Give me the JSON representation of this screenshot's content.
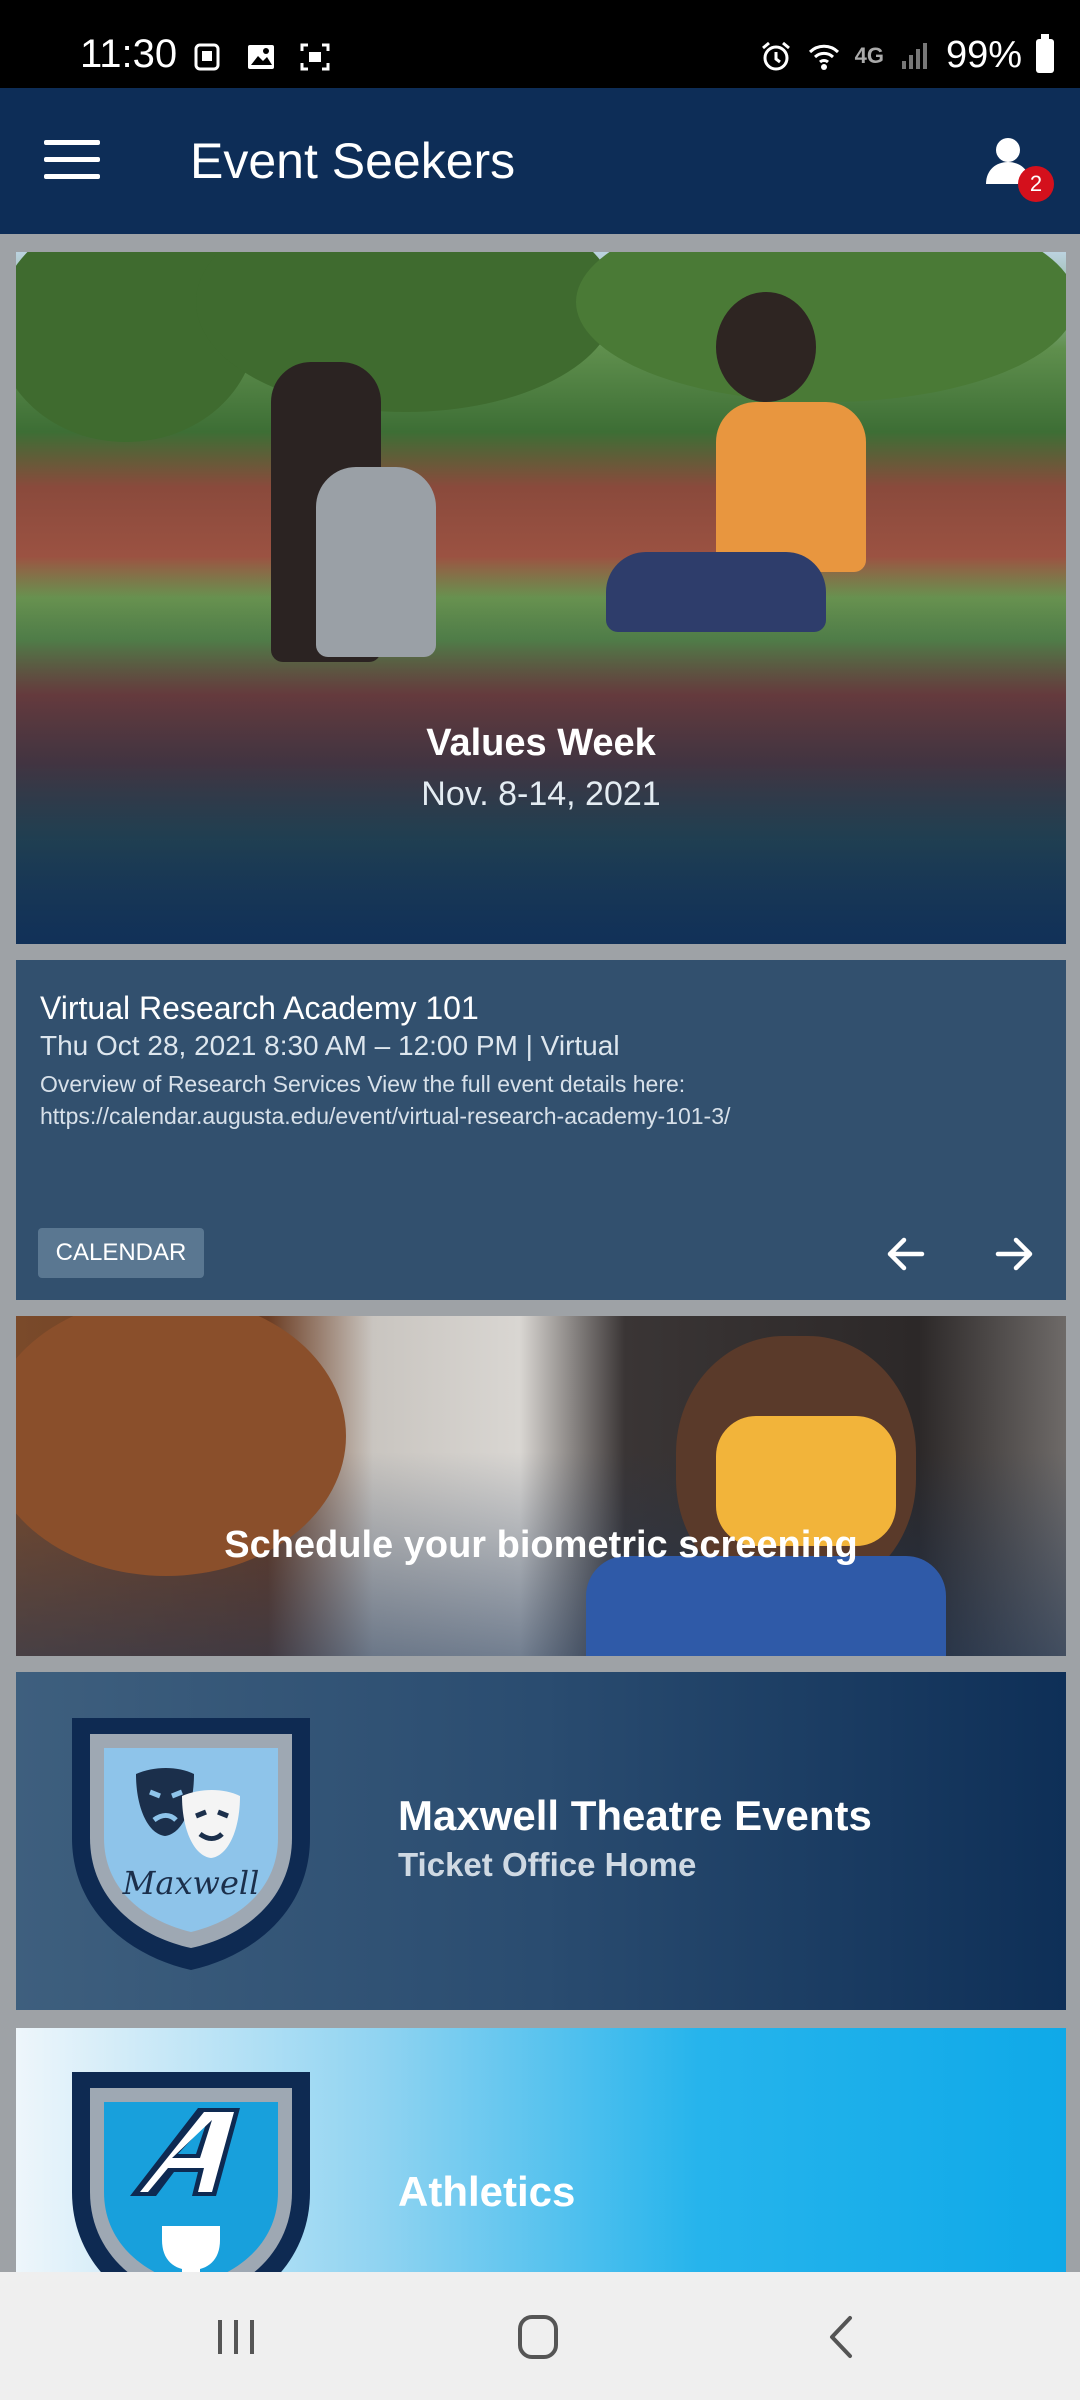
{
  "status_bar": {
    "time": "11:30",
    "left_icons": [
      "notification-icon",
      "image-icon",
      "screenshot-icon"
    ],
    "right_icons": [
      "alarm-icon",
      "wifi-icon",
      "signal-icon"
    ],
    "network": "4G",
    "battery": "99%"
  },
  "app_bar": {
    "title": "Event Seekers",
    "notification_count": "2"
  },
  "hero": {
    "title": "Values Week",
    "subtitle": "Nov. 8-14, 2021"
  },
  "event": {
    "title": "Virtual Research Academy 101",
    "when": "Thu Oct 28, 2021 8:30 AM – 12:00 PM  | Virtual",
    "description": "Overview of Research Services View the full event details here: https://calendar.augusta.edu/event/virtual-research-academy-101-3/",
    "calendar_label": "CALENDAR"
  },
  "biometric": {
    "title": "Schedule your biometric screening"
  },
  "theatre": {
    "title": "Maxwell Theatre Events",
    "subtitle": "Ticket Office Home",
    "logo_text": "Maxwell"
  },
  "athletics": {
    "title": "Athletics"
  },
  "colors": {
    "app_bar": "#0d2d57",
    "event_card": "#32506e",
    "badge": "#d4101c",
    "athletics_accent": "#0fa9e8"
  }
}
